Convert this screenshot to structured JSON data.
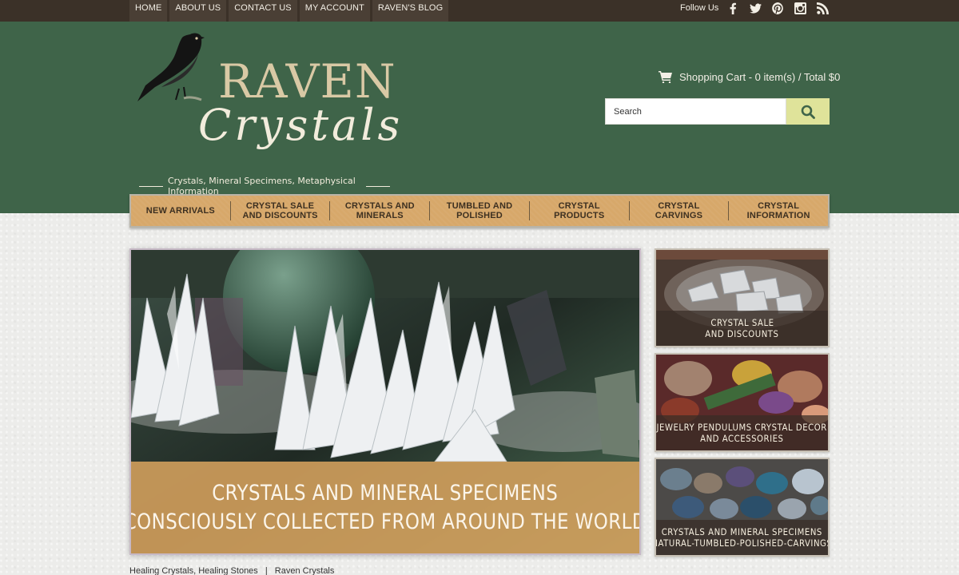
{
  "topnav": {
    "items": [
      {
        "label": "HOME"
      },
      {
        "label": "ABOUT US"
      },
      {
        "label": "CONTACT US"
      },
      {
        "label": "MY ACCOUNT"
      },
      {
        "label": "RAVEN'S BLOG"
      }
    ],
    "follow_label": "Follow Us",
    "social_icons": [
      "facebook-icon",
      "twitter-icon",
      "pinterest-icon",
      "instagram-icon",
      "rss-icon"
    ]
  },
  "header": {
    "logo_word1": "RAVEN",
    "logo_word2": "Crystals",
    "tagline": "Crystals, Mineral Specimens, Metaphysical Information",
    "cart_label": "Shopping Cart - 0 item(s) / Total $0",
    "search_placeholder": "Search",
    "colors": {
      "header_bg": "#3f6449",
      "topbar_bg": "#3b3128",
      "search_button": "#dfe39a"
    }
  },
  "catnav": {
    "items": [
      {
        "line1": "NEW ARRIVALS",
        "line2": ""
      },
      {
        "line1": "CRYSTAL SALE",
        "line2": "AND DISCOUNTS"
      },
      {
        "line1": "CRYSTALS AND",
        "line2": "MINERALS"
      },
      {
        "line1": "TUMBLED AND",
        "line2": "POLISHED"
      },
      {
        "line1": "CRYSTAL",
        "line2": "PRODUCTS"
      },
      {
        "line1": "CRYSTAL",
        "line2": "CARVINGS"
      },
      {
        "line1": "CRYSTAL",
        "line2": "INFORMATION"
      }
    ]
  },
  "banner": {
    "line1": "CRYSTALS AND MINERAL SPECIMENS",
    "line2": "CONSCIOUSLY COLLECTED FROM AROUND THE WORLD"
  },
  "tiles": [
    {
      "line1": "CRYSTAL SALE",
      "line2": "AND DISCOUNTS"
    },
    {
      "line1": "JEWELRY  PENDULUMS CRYSTAL DECOR",
      "line2": "AND ACCESSORIES"
    },
    {
      "line1": "CRYSTALS AND MINERAL SPECIMENS",
      "line2": "NATURAL-TUMBLED-POLISHED-CARVINGS"
    }
  ],
  "breadcrumb": {
    "part1": "Healing Crystals, Healing Stones",
    "sep": "|",
    "part2": "Raven Crystals"
  }
}
